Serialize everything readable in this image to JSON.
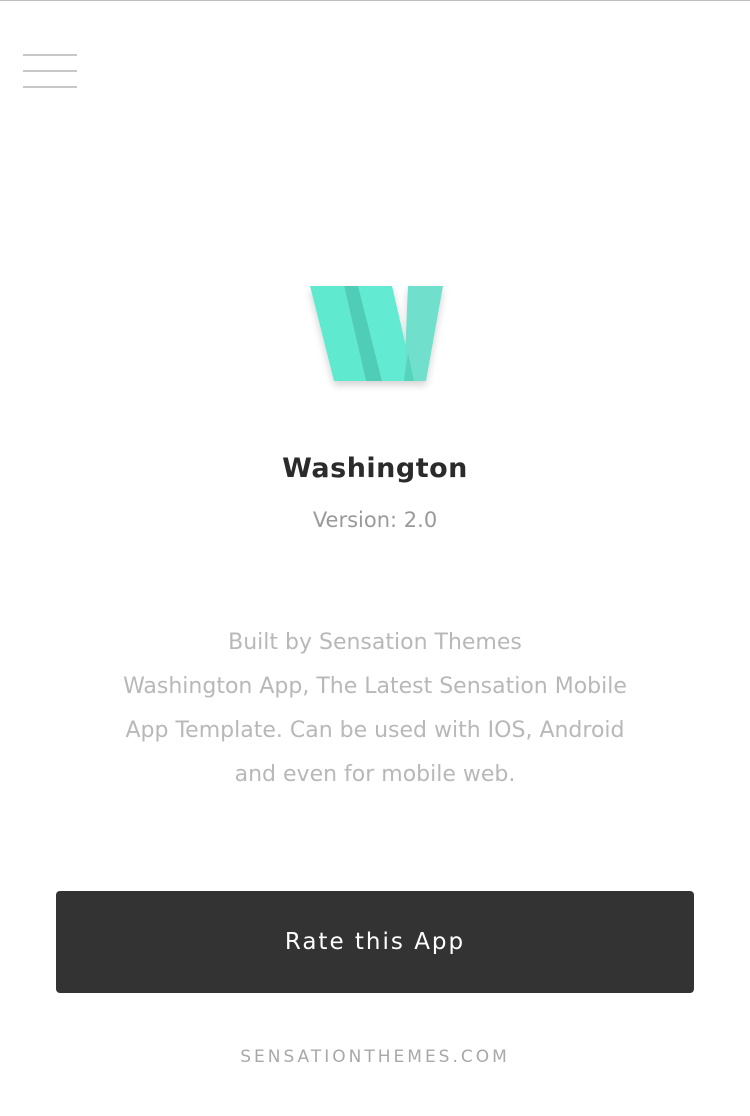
{
  "header": {
    "menu_icon": "hamburger-menu-icon"
  },
  "app": {
    "logo_icon": "washington-w-logo",
    "logo_color": "#5ee8cf",
    "title": "Washington",
    "version": "Version: 2.0"
  },
  "description": {
    "lines": [
      "Built by Sensation Themes",
      "Washington App, The Latest Sensation Mobile",
      "App Template. Can be used with IOS, Android",
      "and even for mobile web."
    ]
  },
  "actions": {
    "rate_label": "Rate this App"
  },
  "footer": {
    "link_text": "SENSATIONTHEMES.COM"
  }
}
